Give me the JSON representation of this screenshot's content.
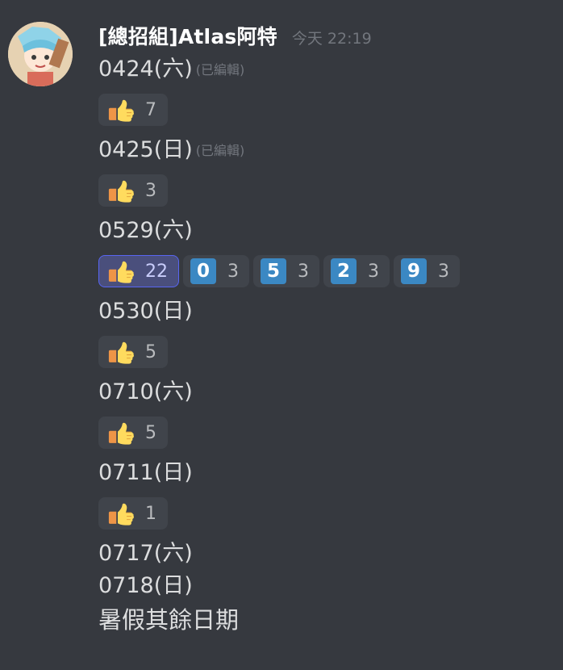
{
  "message": {
    "username": "[總招組]Atlas阿特",
    "timestamp": "今天 22:19",
    "edited_label": "(已編輯)",
    "lines": [
      {
        "text": "0424(六)",
        "edited": true,
        "reactions": [
          {
            "type": "thumbs-up",
            "count": "7",
            "me": false
          }
        ]
      },
      {
        "text": "0425(日)",
        "edited": true,
        "reactions": [
          {
            "type": "thumbs-up",
            "count": "3",
            "me": false
          }
        ]
      },
      {
        "text": "0529(六)",
        "edited": false,
        "reactions": [
          {
            "type": "thumbs-up",
            "count": "22",
            "me": true
          },
          {
            "type": "keycap",
            "key": "0",
            "count": "3",
            "me": false
          },
          {
            "type": "keycap",
            "key": "5",
            "count": "3",
            "me": false
          },
          {
            "type": "keycap",
            "key": "2",
            "count": "3",
            "me": false
          },
          {
            "type": "keycap",
            "key": "9",
            "count": "3",
            "me": false
          }
        ]
      },
      {
        "text": "0530(日)",
        "edited": false,
        "reactions": [
          {
            "type": "thumbs-up",
            "count": "5",
            "me": false
          }
        ]
      },
      {
        "text": "0710(六)",
        "edited": false,
        "reactions": [
          {
            "type": "thumbs-up",
            "count": "5",
            "me": false
          }
        ]
      },
      {
        "text": "0711(日)",
        "edited": false,
        "reactions": [
          {
            "type": "thumbs-up",
            "count": "1",
            "me": false
          }
        ]
      },
      {
        "text": "0717(六)",
        "edited": false,
        "reactions": []
      },
      {
        "text": "0718(日)",
        "edited": false,
        "reactions": []
      }
    ],
    "footer_text": "暑假其餘日期"
  },
  "colors": {
    "background": "#36393f",
    "text": "#dcddde",
    "muted": "#72767d",
    "reaction_bg": "#40444b",
    "reaction_me_bg": "#4a4f7c",
    "reaction_me_border": "#5865f2",
    "keycap": "#3b88c3"
  }
}
